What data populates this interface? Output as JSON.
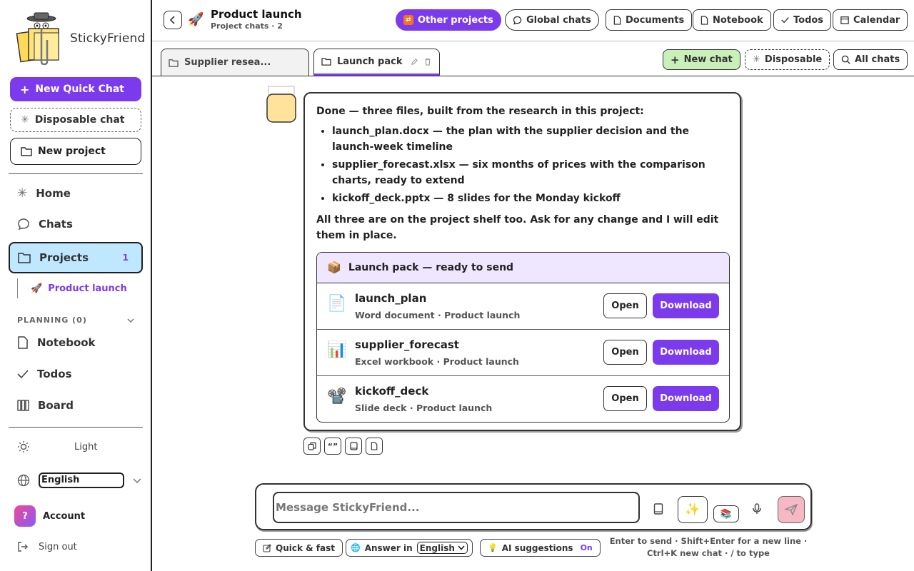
{
  "sidebar": {
    "brand": "StickyFriend",
    "new_quick_chat": "New Quick Chat",
    "disposable_chat": "Disposable chat",
    "new_project": "New project",
    "nav": {
      "home": "Home",
      "chats": "Chats",
      "projects": "Projects",
      "projects_badge": "1"
    },
    "project_item": "Product launch",
    "planning_label": "PLANNING (0)",
    "planning": {
      "notebook": "Notebook",
      "todos": "Todos",
      "board": "Board"
    },
    "theme": "Light",
    "language": "English",
    "account_initial": "?",
    "account": "Account",
    "sign_out": "Sign out"
  },
  "topbar": {
    "title": "Product launch",
    "subtitle": "Project chats · 2",
    "other_projects": "Other projects",
    "global_chats": "Global chats",
    "documents": "Documents",
    "notebook": "Notebook",
    "todos": "Todos",
    "calendar": "Calendar"
  },
  "tabs": [
    {
      "label": "Supplier resea..."
    },
    {
      "label": "Launch pack"
    }
  ],
  "tab_actions": {
    "new_chat": "New chat",
    "disposable": "Disposable",
    "all_chats": "All chats"
  },
  "message": {
    "intro": "Done — three files, built from the research in this project:",
    "bullets": [
      "launch_plan.docx — the plan with the supplier decision and the launch-week timeline",
      "supplier_forecast.xlsx — six months of prices with the comparison charts, ready to extend",
      "kickoff_deck.pptx — 8 slides for the Monday kickoff"
    ],
    "outro": "All three are on the project shelf too. Ask for any change and I will edit them in place.",
    "pack_title": "Launch pack — ready to send",
    "files": [
      {
        "name": "launch_plan",
        "meta": "Word document · Product launch",
        "icon": "document-icon"
      },
      {
        "name": "supplier_forecast",
        "meta": "Excel workbook · Product launch",
        "icon": "chart-icon"
      },
      {
        "name": "kickoff_deck",
        "meta": "Slide deck · Product launch",
        "icon": "projector-icon"
      }
    ],
    "open_label": "Open",
    "download_label": "Download"
  },
  "composer": {
    "placeholder": "Message StickyFriend...",
    "quick_fast": "Quick & fast",
    "answer_in": "Answer in",
    "answer_lang": "English",
    "ai_suggestions": "AI suggestions",
    "ai_state": "On",
    "hint_line1": "Enter to send · Shift+Enter for a new line ·",
    "hint_line2": "Ctrl+K new chat · / to type"
  },
  "colors": {
    "accent": "#7c3aed",
    "projects_bg": "#bfe8ff",
    "new_chat_bg": "#c8f0b8",
    "pack_head_bg": "#efe6ff"
  }
}
